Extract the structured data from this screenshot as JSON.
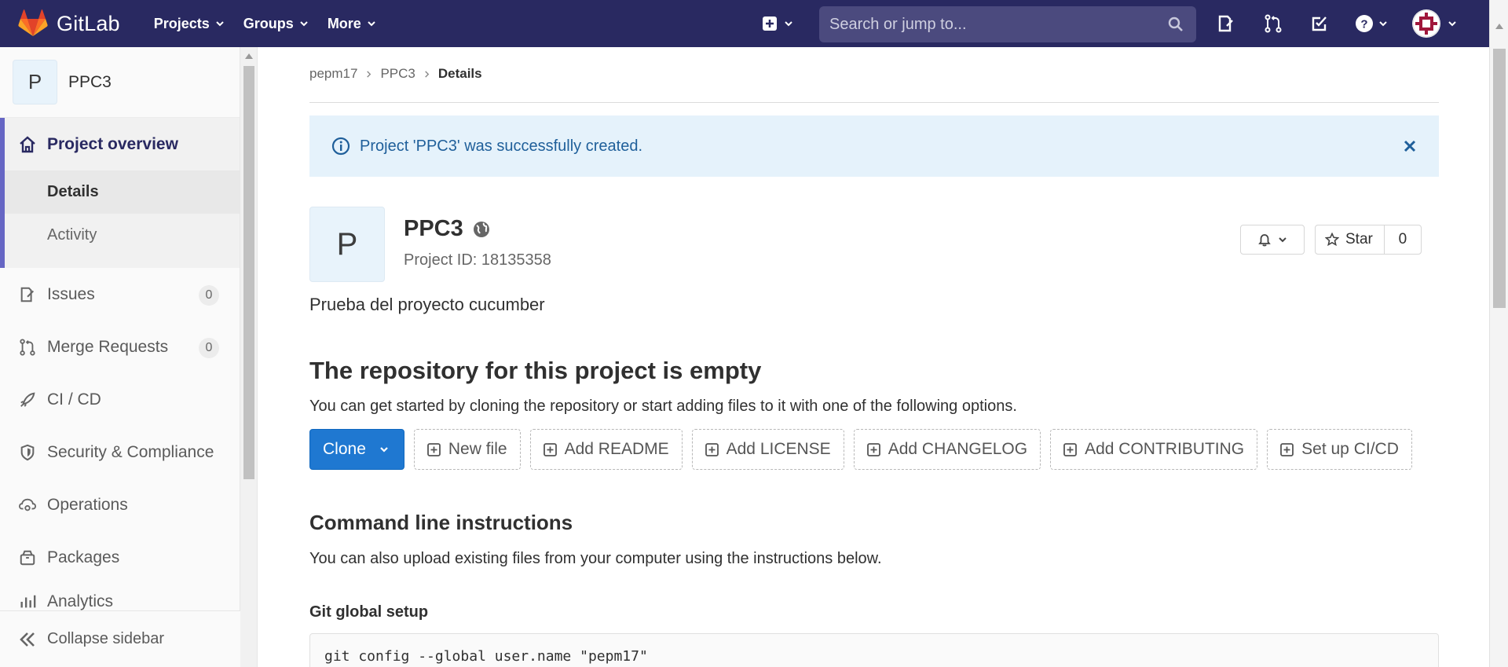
{
  "navbar": {
    "brand": "GitLab",
    "menu": [
      {
        "label": "Projects",
        "icon": "chevron-down-icon"
      },
      {
        "label": "Groups",
        "icon": "chevron-down-icon"
      },
      {
        "label": "More",
        "icon": "chevron-down-icon"
      }
    ],
    "search_placeholder": "Search or jump to...",
    "bg_color": "#292961"
  },
  "sidebar": {
    "project_initial": "P",
    "project_name": "PPC3",
    "overview_label": "Project overview",
    "sub_items": [
      {
        "label": "Details",
        "active": true
      },
      {
        "label": "Activity",
        "active": false
      }
    ],
    "items": [
      {
        "label": "Issues",
        "count": "0",
        "icon": "issues-icon"
      },
      {
        "label": "Merge Requests",
        "count": "0",
        "icon": "merge-request-icon"
      },
      {
        "label": "CI / CD",
        "icon": "rocket-icon"
      },
      {
        "label": "Security & Compliance",
        "icon": "shield-icon"
      },
      {
        "label": "Operations",
        "icon": "cloud-gear-icon"
      },
      {
        "label": "Packages",
        "icon": "package-icon"
      },
      {
        "label": "Analytics",
        "icon": "chart-icon"
      }
    ],
    "collapse_label": "Collapse sidebar"
  },
  "breadcrumb": [
    "pepm17",
    "PPC3",
    "Details"
  ],
  "alert": {
    "text": "Project 'PPC3' was successfully created."
  },
  "project": {
    "initial": "P",
    "name": "PPC3",
    "id_text": "Project ID: 18135358",
    "description": "Prueba del proyecto cucumber",
    "star_label": "Star",
    "star_count": "0"
  },
  "empty_repo": {
    "heading": "The repository for this project is empty",
    "text": "You can get started by cloning the repository or start adding files to it with one of the following options.",
    "clone_label": "Clone",
    "buttons": [
      "New file",
      "Add README",
      "Add LICENSE",
      "Add CHANGELOG",
      "Add CONTRIBUTING",
      "Set up CI/CD"
    ]
  },
  "command_line": {
    "heading": "Command line instructions",
    "text": "You can also upload existing files from your computer using the instructions below.",
    "git_setup_heading": "Git global setup",
    "code_line": "git config --global user.name \"pepm17\""
  },
  "colors": {
    "accent": "#1f78d1",
    "alert_bg": "#e5f2fb",
    "alert_text": "#1f5f9a",
    "sidebar_active": "#6666c4"
  }
}
